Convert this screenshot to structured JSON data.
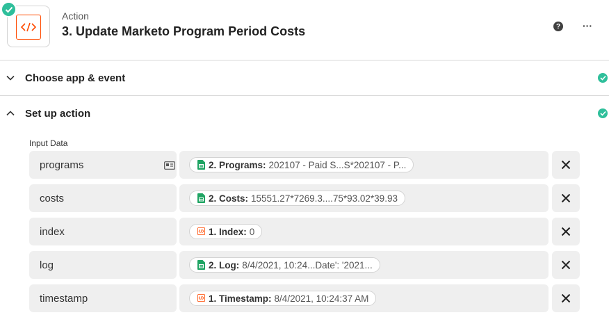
{
  "step": {
    "label": "Action",
    "title": "3. Update Marketo Program Period Costs",
    "app_icon": "code-icon",
    "status_icon": "check-icon"
  },
  "header_actions": {
    "help_icon": "help-icon",
    "help_glyph": "?",
    "more_icon": "more-icon",
    "more_glyph": "···"
  },
  "sections": [
    {
      "title": "Choose app & event",
      "expanded": false,
      "complete": true
    },
    {
      "title": "Set up action",
      "expanded": true,
      "complete": true
    }
  ],
  "input_data_label": "Input Data",
  "fields": [
    {
      "name": "programs",
      "has_field_icon": true,
      "source_icon": "google-sheets-icon",
      "mapped_key": "2. Programs:",
      "mapped_value": "202107 - Paid S...S*202107 - P..."
    },
    {
      "name": "costs",
      "has_field_icon": false,
      "source_icon": "google-sheets-icon",
      "mapped_key": "2. Costs:",
      "mapped_value": "15551.27*7269.3....75*93.02*39.93"
    },
    {
      "name": "index",
      "has_field_icon": false,
      "source_icon": "code-step-icon",
      "mapped_key": "1. Index:",
      "mapped_value": "0"
    },
    {
      "name": "log",
      "has_field_icon": false,
      "source_icon": "google-sheets-icon",
      "mapped_key": "2. Log:",
      "mapped_value": "8/4/2021, 10:24...Date': '2021..."
    },
    {
      "name": "timestamp",
      "has_field_icon": false,
      "source_icon": "code-step-icon",
      "mapped_key": "1. Timestamp:",
      "mapped_value": "8/4/2021, 10:24:37 AM"
    }
  ],
  "colors": {
    "accent_orange": "#ff4a00",
    "success_green": "#2fbf9b",
    "sheets_green": "#1fa463",
    "field_bg": "#efefef"
  }
}
